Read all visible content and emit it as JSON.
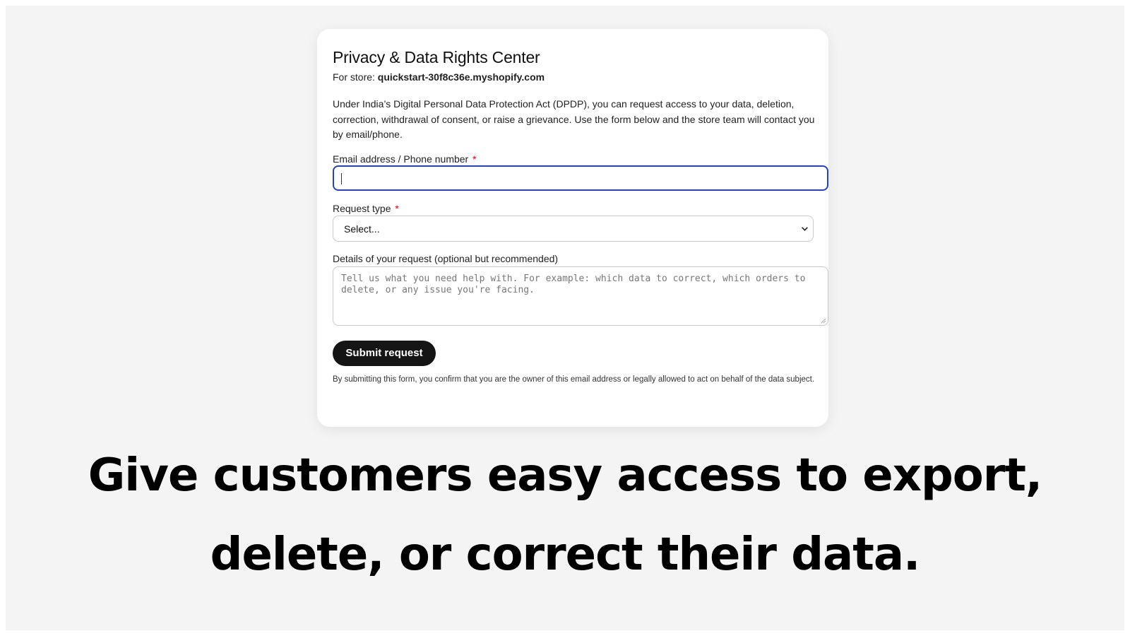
{
  "card": {
    "title": "Privacy & Data Rights Center",
    "store_prefix": "For store:",
    "store_name": "quickstart-30f8c36e.myshopify.com",
    "intro": "Under India’s Digital Personal Data Protection Act (DPDP), you can request access to your data, deletion, correction, withdrawal of consent, or raise a grievance. Use the form below and the store team will contact you by email/phone."
  },
  "form": {
    "email_label": "Email address / Phone number",
    "email_value": "",
    "required_mark": "*",
    "request_type_label": "Request type",
    "request_type_selected": "Select...",
    "details_label": "Details of your request (optional but recommended)",
    "details_placeholder": "Tell us what you need help with. For example: which data to correct, which orders to delete, or any issue you're facing.",
    "submit_label": "Submit request",
    "disclaimer": "By submitting this form, you confirm that you are the owner of this email address or legally allowed to act on behalf of the data subject."
  },
  "headline": {
    "line1": "Give customers easy access to export,",
    "line2": "delete, or correct their data."
  },
  "colors": {
    "background": "#f4f4f4",
    "card": "#ffffff",
    "focus_border": "#2544b8",
    "required": "#d0021b",
    "button": "#151515"
  },
  "icons": {
    "select_chevron": "chevron-down-icon",
    "textarea_resize": "resize-grip-icon"
  }
}
